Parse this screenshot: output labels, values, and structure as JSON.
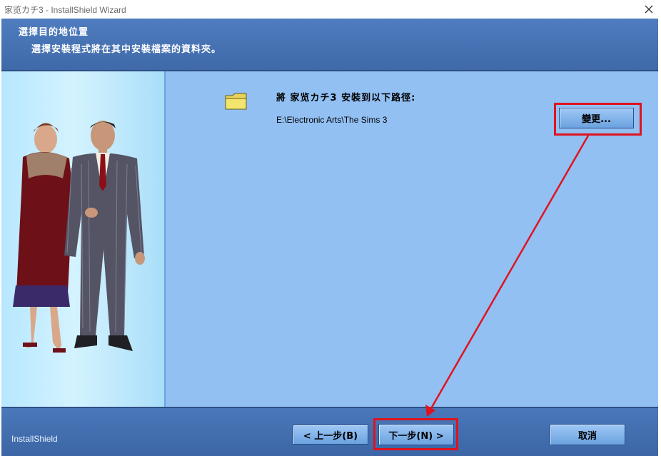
{
  "window": {
    "title": "家览カチ3 - InstallShield Wizard"
  },
  "banner": {
    "title": "選擇目的地位置",
    "subtitle": "選擇安裝程式將在其中安裝檔案的資料夾。"
  },
  "content": {
    "install_label": "將 家览カチ3 安裝到以下路徑:",
    "install_path": "E:\\Electronic Arts\\The Sims 3",
    "change_label": "變更..."
  },
  "footer": {
    "brand": "InstallShield",
    "back_label": "< 上一步(B)",
    "next_label": "下一步(N) >",
    "cancel_label": "取消"
  },
  "colors": {
    "annotation": "#e0131e",
    "banner": "#4f7dbf",
    "panel": "#92c0f3"
  }
}
